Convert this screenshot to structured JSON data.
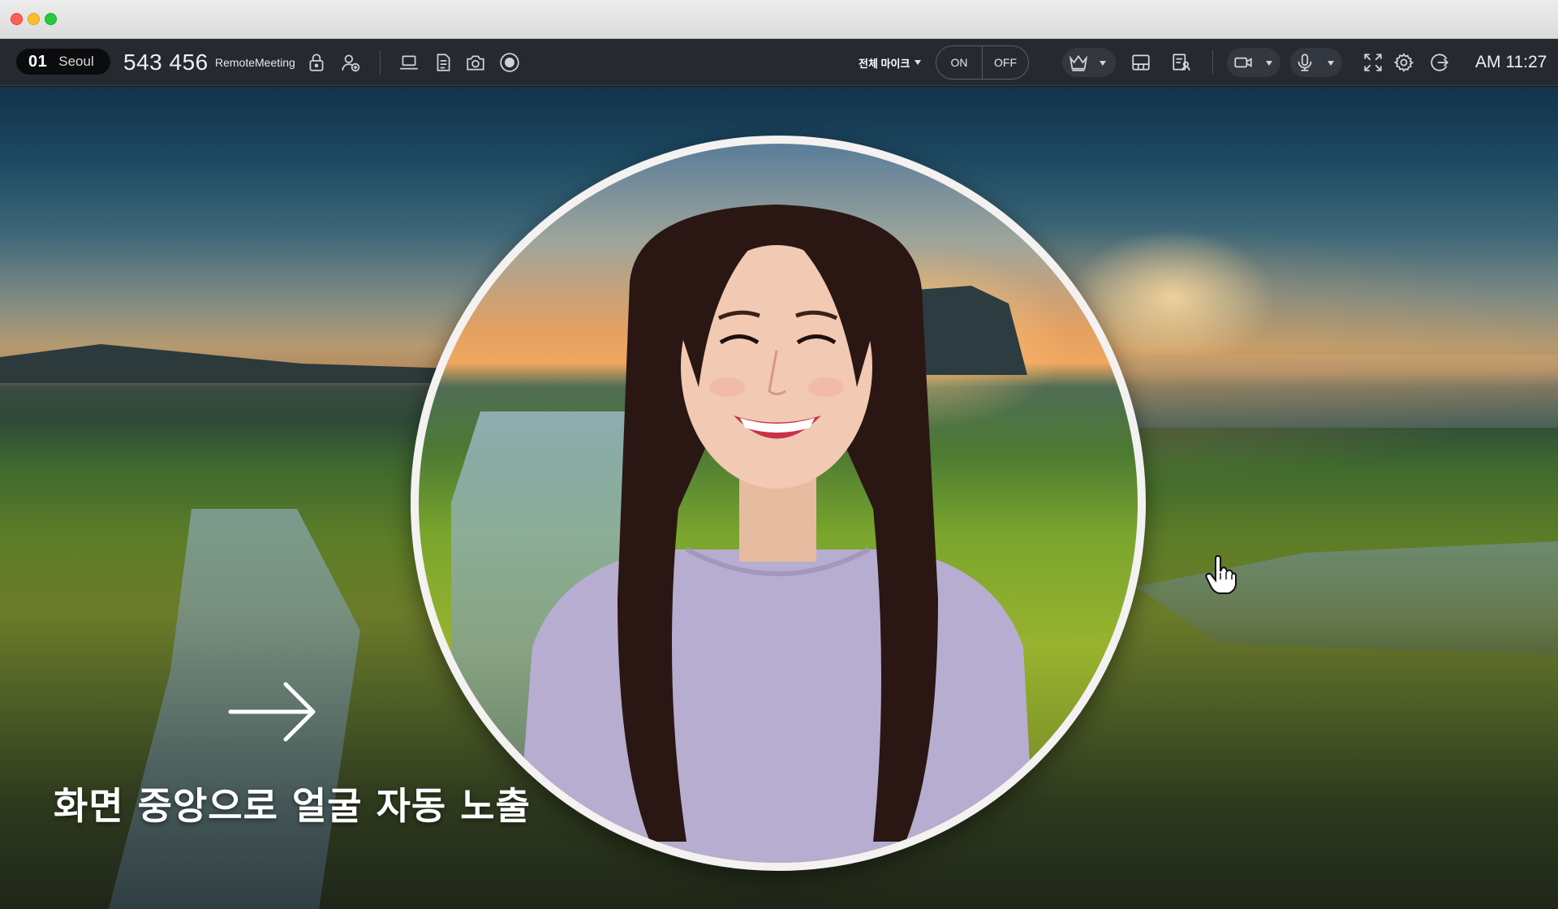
{
  "window": {
    "controls": [
      "close",
      "minimize",
      "zoom"
    ]
  },
  "toolbar": {
    "room_number": "01",
    "room_city": "Seoul",
    "meeting_id": "543 456",
    "meeting_name": "RemoteMeeting",
    "mic_all_label": "전체 마이크",
    "toggle_on": "ON",
    "toggle_off": "OFF",
    "clock": "AM 11:27"
  },
  "icons": {
    "left_group": [
      "lock-icon",
      "add-user-icon",
      "screen-share-icon",
      "document-icon",
      "camera-capture-icon",
      "record-icon"
    ],
    "right_group": [
      "crown-icon",
      "layout-icon",
      "document-user-icon",
      "video-camera-icon",
      "microphone-icon",
      "fullscreen-icon",
      "gear-icon",
      "exit-icon"
    ]
  },
  "stage": {
    "caption": "화면 중앙으로 얼굴 자동 노출"
  },
  "colors": {
    "toolbar_bg": "#262a30",
    "titlebar_bg": "#e4e4e4",
    "circle_border": "#f4f1f1"
  }
}
